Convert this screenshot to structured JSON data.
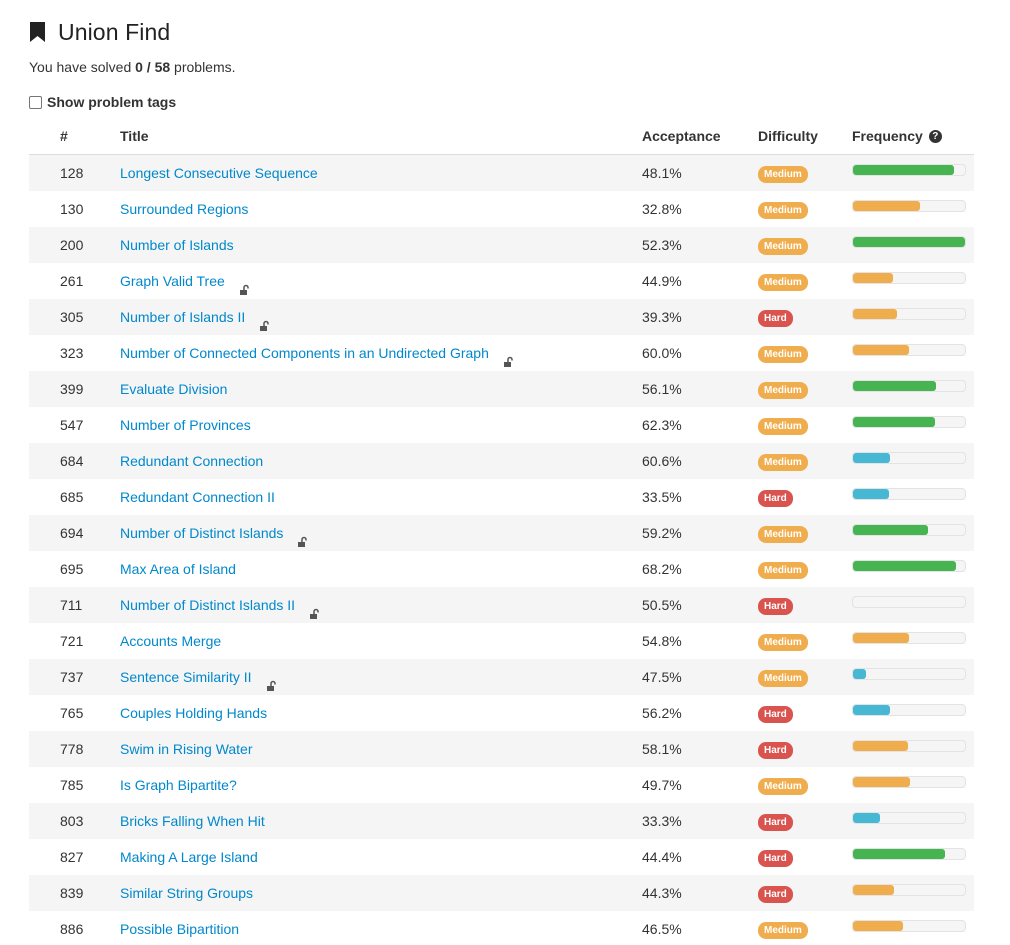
{
  "header": {
    "title": "Union Find",
    "icon": "bookmark-icon"
  },
  "solved": {
    "prefix": "You have solved",
    "count": "0 / 58",
    "suffix": "problems."
  },
  "tags_toggle": {
    "label": "Show problem tags",
    "checked": false
  },
  "table": {
    "columns": {
      "num": "#",
      "title": "Title",
      "acceptance": "Acceptance",
      "difficulty": "Difficulty",
      "frequency": "Frequency",
      "frequency_help_icon": "question-circle-icon"
    },
    "colors": {
      "medium": "#f0ad4e",
      "hard": "#d9534f",
      "freq_green": "#46b450",
      "freq_orange": "#f0ad4e",
      "freq_blue": "#47b8d4",
      "link": "#0088cc"
    },
    "rows": [
      {
        "num": "128",
        "title": "Longest Consecutive Sequence",
        "locked": false,
        "acceptance": "48.1%",
        "difficulty": "Medium",
        "frequency": 0.9,
        "freq_color": "green"
      },
      {
        "num": "130",
        "title": "Surrounded Regions",
        "locked": false,
        "acceptance": "32.8%",
        "difficulty": "Medium",
        "frequency": 0.6,
        "freq_color": "orange"
      },
      {
        "num": "200",
        "title": "Number of Islands",
        "locked": false,
        "acceptance": "52.3%",
        "difficulty": "Medium",
        "frequency": 1.0,
        "freq_color": "green"
      },
      {
        "num": "261",
        "title": "Graph Valid Tree",
        "locked": true,
        "acceptance": "44.9%",
        "difficulty": "Medium",
        "frequency": 0.36,
        "freq_color": "orange"
      },
      {
        "num": "305",
        "title": "Number of Islands II",
        "locked": true,
        "acceptance": "39.3%",
        "difficulty": "Hard",
        "frequency": 0.39,
        "freq_color": "orange"
      },
      {
        "num": "323",
        "title": "Number of Connected Components in an Undirected Graph",
        "locked": true,
        "acceptance": "60.0%",
        "difficulty": "Medium",
        "frequency": 0.5,
        "freq_color": "orange"
      },
      {
        "num": "399",
        "title": "Evaluate Division",
        "locked": false,
        "acceptance": "56.1%",
        "difficulty": "Medium",
        "frequency": 0.74,
        "freq_color": "green"
      },
      {
        "num": "547",
        "title": "Number of Provinces",
        "locked": false,
        "acceptance": "62.3%",
        "difficulty": "Medium",
        "frequency": 0.73,
        "freq_color": "green"
      },
      {
        "num": "684",
        "title": "Redundant Connection",
        "locked": false,
        "acceptance": "60.6%",
        "difficulty": "Medium",
        "frequency": 0.33,
        "freq_color": "blue"
      },
      {
        "num": "685",
        "title": "Redundant Connection II",
        "locked": false,
        "acceptance": "33.5%",
        "difficulty": "Hard",
        "frequency": 0.32,
        "freq_color": "blue"
      },
      {
        "num": "694",
        "title": "Number of Distinct Islands",
        "locked": true,
        "acceptance": "59.2%",
        "difficulty": "Medium",
        "frequency": 0.67,
        "freq_color": "green"
      },
      {
        "num": "695",
        "title": "Max Area of Island",
        "locked": false,
        "acceptance": "68.2%",
        "difficulty": "Medium",
        "frequency": 0.92,
        "freq_color": "green"
      },
      {
        "num": "711",
        "title": "Number of Distinct Islands II",
        "locked": true,
        "acceptance": "50.5%",
        "difficulty": "Hard",
        "frequency": 0.0,
        "freq_color": "green"
      },
      {
        "num": "721",
        "title": "Accounts Merge",
        "locked": false,
        "acceptance": "54.8%",
        "difficulty": "Medium",
        "frequency": 0.5,
        "freq_color": "orange"
      },
      {
        "num": "737",
        "title": "Sentence Similarity II",
        "locked": true,
        "acceptance": "47.5%",
        "difficulty": "Medium",
        "frequency": 0.12,
        "freq_color": "blue"
      },
      {
        "num": "765",
        "title": "Couples Holding Hands",
        "locked": false,
        "acceptance": "56.2%",
        "difficulty": "Hard",
        "frequency": 0.33,
        "freq_color": "blue"
      },
      {
        "num": "778",
        "title": "Swim in Rising Water",
        "locked": false,
        "acceptance": "58.1%",
        "difficulty": "Hard",
        "frequency": 0.49,
        "freq_color": "orange"
      },
      {
        "num": "785",
        "title": "Is Graph Bipartite?",
        "locked": false,
        "acceptance": "49.7%",
        "difficulty": "Medium",
        "frequency": 0.51,
        "freq_color": "orange"
      },
      {
        "num": "803",
        "title": "Bricks Falling When Hit",
        "locked": false,
        "acceptance": "33.3%",
        "difficulty": "Hard",
        "frequency": 0.24,
        "freq_color": "blue"
      },
      {
        "num": "827",
        "title": "Making A Large Island",
        "locked": false,
        "acceptance": "44.4%",
        "difficulty": "Hard",
        "frequency": 0.82,
        "freq_color": "green"
      },
      {
        "num": "839",
        "title": "Similar String Groups",
        "locked": false,
        "acceptance": "44.3%",
        "difficulty": "Hard",
        "frequency": 0.37,
        "freq_color": "orange"
      },
      {
        "num": "886",
        "title": "Possible Bipartition",
        "locked": false,
        "acceptance": "46.5%",
        "difficulty": "Medium",
        "frequency": 0.45,
        "freq_color": "orange"
      }
    ]
  }
}
